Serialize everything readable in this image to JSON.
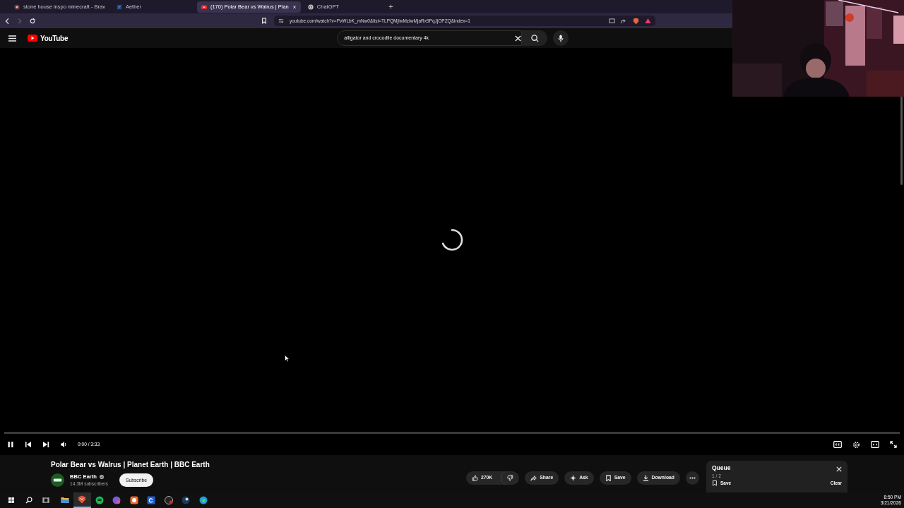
{
  "browser": {
    "tabs": [
      {
        "title": "stone house inspo minecraft - Brav",
        "kind": "brave",
        "selected": false
      },
      {
        "title": "Aether",
        "kind": "aether",
        "selected": false
      },
      {
        "title": "(170) Polar Bear vs Walrus | Plan",
        "kind": "youtube",
        "selected": true
      },
      {
        "title": "ChatGPT",
        "kind": "chatgpt",
        "selected": false
      }
    ],
    "url": "youtube.com/watch?v=PvWLbK_mNw0&list=TLPQMjIwMzIwMjaRx9PqJjOPZQ&index=1"
  },
  "youtube": {
    "logo": "YouTube",
    "search": {
      "value": "alligator and crocodile documentary 4k"
    }
  },
  "player": {
    "playing": true,
    "progress": {
      "level": 0
    },
    "time": "0:00 / 3:33"
  },
  "video": {
    "title": "Polar Bear vs Walrus | Planet Earth | BBC Earth",
    "channel": "BBC Earth",
    "verified": true,
    "subscribers": "14.3M subscribers",
    "subscribe": "Subscribe",
    "actions": [
      {
        "kind": "like",
        "label": "270K"
      },
      {
        "kind": "share",
        "label": "Share"
      },
      {
        "kind": "ask",
        "label": "Ask"
      },
      {
        "kind": "save",
        "label": "Save"
      },
      {
        "kind": "download",
        "label": "Download"
      },
      {
        "kind": "more"
      }
    ]
  },
  "queue": {
    "title": "Queue",
    "position": "1 / 2",
    "save": "Save",
    "clear": "Clear"
  },
  "taskbar": {
    "apps": [
      {
        "kind": "files",
        "selected": false
      },
      {
        "kind": "brave",
        "selected": true
      },
      {
        "kind": "spotify",
        "selected": false
      },
      {
        "kind": "discord",
        "selected": false
      },
      {
        "kind": "orange",
        "selected": false
      },
      {
        "kind": "blue",
        "selected": false
      },
      {
        "kind": "obs",
        "selected": false
      },
      {
        "kind": "steam",
        "selected": false
      },
      {
        "kind": "edge",
        "selected": false
      }
    ],
    "time": "8:50 PM",
    "date": "3/21/2026"
  }
}
